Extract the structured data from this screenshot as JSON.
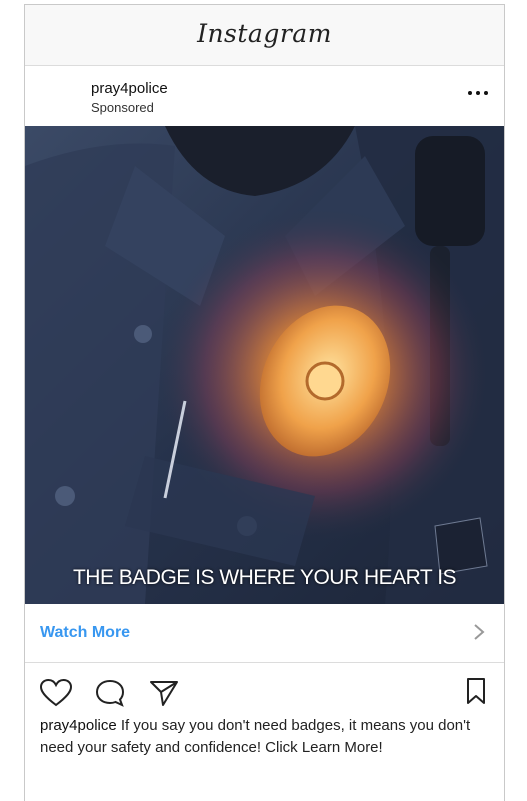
{
  "app": {
    "title": "Instagram"
  },
  "post": {
    "username": "pray4police",
    "sponsored_label": "Sponsored",
    "image_caption": "THE BADGE IS WHERE YOUR HEART IS",
    "cta_label": "Watch More",
    "caption_user": "pray4police",
    "caption_text": " If you say you don't need badges, it means you don't need your safety and confidence! Click Learn More!"
  },
  "icons": {
    "more": "more-options-icon",
    "chevron": "chevron-right-icon",
    "like": "heart-icon",
    "comment": "comment-icon",
    "share": "paper-plane-icon",
    "save": "bookmark-icon"
  },
  "colors": {
    "accent": "#3897f0",
    "text": "#222222",
    "badge_glow": "#f5a340"
  }
}
